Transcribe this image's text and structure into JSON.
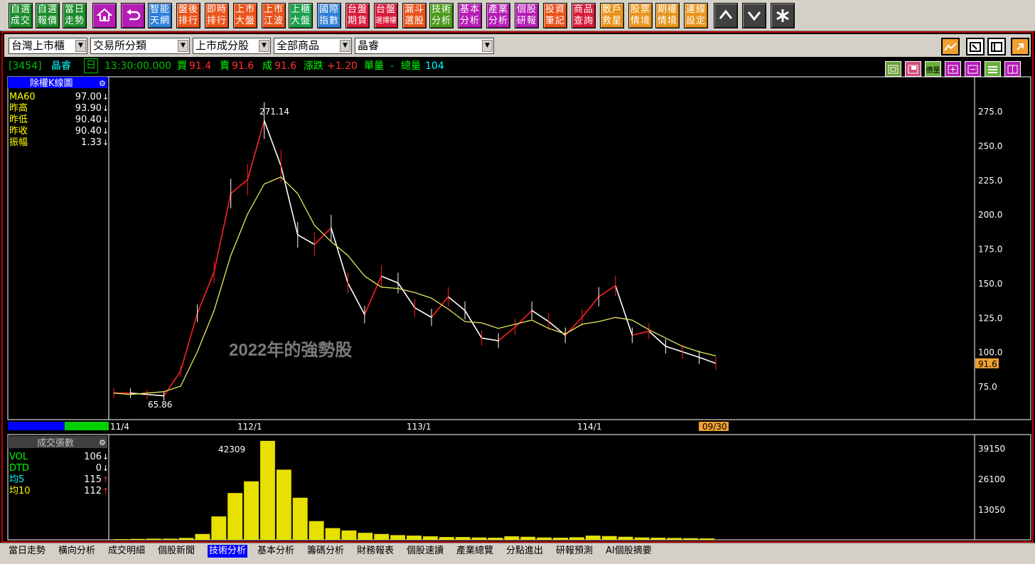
{
  "toolbar": {
    "buttons": [
      {
        "l1": "自選",
        "l2": "成交",
        "color": "#1c8c2c"
      },
      {
        "l1": "自選",
        "l2": "報價",
        "color": "#1c8c2c"
      },
      {
        "l1": "當日",
        "l2": "走勢",
        "color": "#1c8c2c"
      },
      {
        "l1": "智能",
        "l2": "天網",
        "color": "#2f7fd8"
      },
      {
        "l1": "盤後",
        "l2": "排行",
        "color": "#e8541c"
      },
      {
        "l1": "即時",
        "l2": "排行",
        "color": "#e8541c"
      },
      {
        "l1": "上市",
        "l2": "大盤",
        "color": "#e8541c"
      },
      {
        "l1": "上市",
        "l2": "江波",
        "color": "#e8541c"
      },
      {
        "l1": "上櫃",
        "l2": "大盤",
        "color": "#1ca04c"
      },
      {
        "l1": "國際",
        "l2": "指數",
        "color": "#2f7fd8"
      },
      {
        "l1": "台盤",
        "l2": "期貨",
        "color": "#d81c3c"
      },
      {
        "l1": "台盤",
        "l2": "選擇權",
        "color": "#d81c3c"
      },
      {
        "l1": "漏斗",
        "l2": "選股",
        "color": "#e8541c"
      },
      {
        "l1": "技術",
        "l2": "分析",
        "color": "#4c9c1c"
      },
      {
        "l1": "基本",
        "l2": "分析",
        "color": "#b41cb4"
      },
      {
        "l1": "產業",
        "l2": "分析",
        "color": "#b41cb4"
      },
      {
        "l1": "個股",
        "l2": "研報",
        "color": "#b41cb4"
      },
      {
        "l1": "投資",
        "l2": "筆記",
        "color": "#e8541c"
      },
      {
        "l1": "商品",
        "l2": "查詢",
        "color": "#d81c3c"
      },
      {
        "l1": "散戶",
        "l2": "救星",
        "color": "#e8941c"
      },
      {
        "l1": "股票",
        "l2": "情境",
        "color": "#e8941c"
      },
      {
        "l1": "期權",
        "l2": "情境",
        "color": "#e8941c"
      },
      {
        "l1": "連線",
        "l2": "設定",
        "color": "#e8941c"
      }
    ],
    "home_icon": "home-icon",
    "back_icon": "return-arrow-icon",
    "up_icon": "arrow-up-icon",
    "down_icon": "arrow-down-icon",
    "star_icon": "asterisk-icon"
  },
  "selectors": {
    "market": "台灣上市櫃",
    "category": "交易所分類",
    "group": "上市成分股",
    "product": "全部商品",
    "stock": "晶睿"
  },
  "quote": {
    "code": "[3454]",
    "name": "晶睿",
    "period": "日",
    "time": "13:30:00.000",
    "bid_label": "買",
    "bid": "91.4",
    "ask_label": "賣",
    "ask": "91.6",
    "deal_label": "成",
    "deal": "91.6",
    "change_label": "漲跌",
    "change": "+1.20",
    "unit_label": "單量",
    "unit": "-",
    "total_label": "總量",
    "total": "104",
    "toggle_buttons": [
      "價量"
    ]
  },
  "price_panel": {
    "title": "除權K線圖",
    "indicators": [
      {
        "label": "MA60",
        "value": "97.00",
        "arrow": "↓"
      },
      {
        "label": "昨高",
        "value": "93.90",
        "arrow": "↓"
      },
      {
        "label": "昨低",
        "value": "90.40",
        "arrow": "↓"
      },
      {
        "label": "昨收",
        "value": "90.40",
        "arrow": "↓"
      },
      {
        "label": "振幅",
        "value": "1.33",
        "arrow": "↓"
      }
    ],
    "current_price_tag": "91.6",
    "high_label": "271.14",
    "low_label": "65.86"
  },
  "volume_panel": {
    "title": "成交張數",
    "indicators": [
      {
        "label": "VOL",
        "value": "106",
        "arrow": "↓",
        "color": "#00ff00"
      },
      {
        "label": "DTD",
        "value": "0",
        "arrow": "↓",
        "color": "#00ff00"
      },
      {
        "label": "均5",
        "value": "115",
        "arrow": "↑",
        "color": "#00ffff"
      },
      {
        "label": "均10",
        "value": "112",
        "arrow": "↑",
        "color": "#ffff00"
      }
    ],
    "peak_label": "42309"
  },
  "x_axis_labels": [
    "11/4",
    "112/1",
    "113/1",
    "114/1",
    "09/30"
  ],
  "watermark": "2022年的強勢股",
  "tabs": [
    "當日走勢",
    "橫向分析",
    "成交明細",
    "個股新聞",
    "技術分析",
    "基本分析",
    "籌碼分析",
    "財務報表",
    "個股速讀",
    "產業總覽",
    "分點進出",
    "研報預測",
    "AI個股摘要"
  ],
  "active_tab": "技術分析",
  "chart_data": [
    {
      "type": "line",
      "title": "除權K線圖",
      "y_ticks": [
        75.0,
        100.0,
        125.0,
        150.0,
        175.0,
        200.0,
        225.0,
        250.0,
        275.0
      ],
      "ylim": [
        50,
        290
      ],
      "x_tick_labels": [
        "11/4",
        "112/1",
        "113/1",
        "114/1",
        "09/30"
      ],
      "series": [
        {
          "name": "MA60",
          "values": [
            70,
            69,
            70,
            71,
            75,
            100,
            130,
            170,
            200,
            222,
            227,
            215,
            192,
            180,
            170,
            155,
            147,
            146,
            143,
            139,
            131,
            122,
            121,
            117,
            120,
            123,
            117,
            113,
            120,
            122,
            125,
            123,
            116,
            110,
            104,
            100,
            97
          ]
        },
        {
          "values": [
            70,
            70,
            69,
            68,
            86,
            128,
            158,
            215,
            225,
            268,
            235,
            185,
            178,
            190,
            150,
            127,
            155,
            150,
            132,
            125,
            140,
            130,
            110,
            108,
            118,
            130,
            122,
            112,
            125,
            140,
            148,
            112,
            115,
            104,
            100,
            96,
            91.6
          ]
        }
      ],
      "annotations": [
        {
          "text": "271.14"
        },
        {
          "text": "65.86"
        }
      ],
      "last_price": 91.6
    },
    {
      "type": "bar",
      "title": "成交張數",
      "y_ticks": [
        13050,
        26100,
        39150
      ],
      "ylim": [
        0,
        45000
      ],
      "values": [
        300,
        400,
        500,
        500,
        800,
        2500,
        10000,
        20000,
        25000,
        42309,
        30000,
        18000,
        8000,
        5000,
        4000,
        3000,
        2500,
        2000,
        1800,
        1500,
        1200,
        1200,
        1000,
        900,
        1500,
        1300,
        1000,
        900,
        1100,
        1800,
        1600,
        1300,
        1000,
        900,
        800,
        700,
        600
      ],
      "peak": 42309
    }
  ]
}
